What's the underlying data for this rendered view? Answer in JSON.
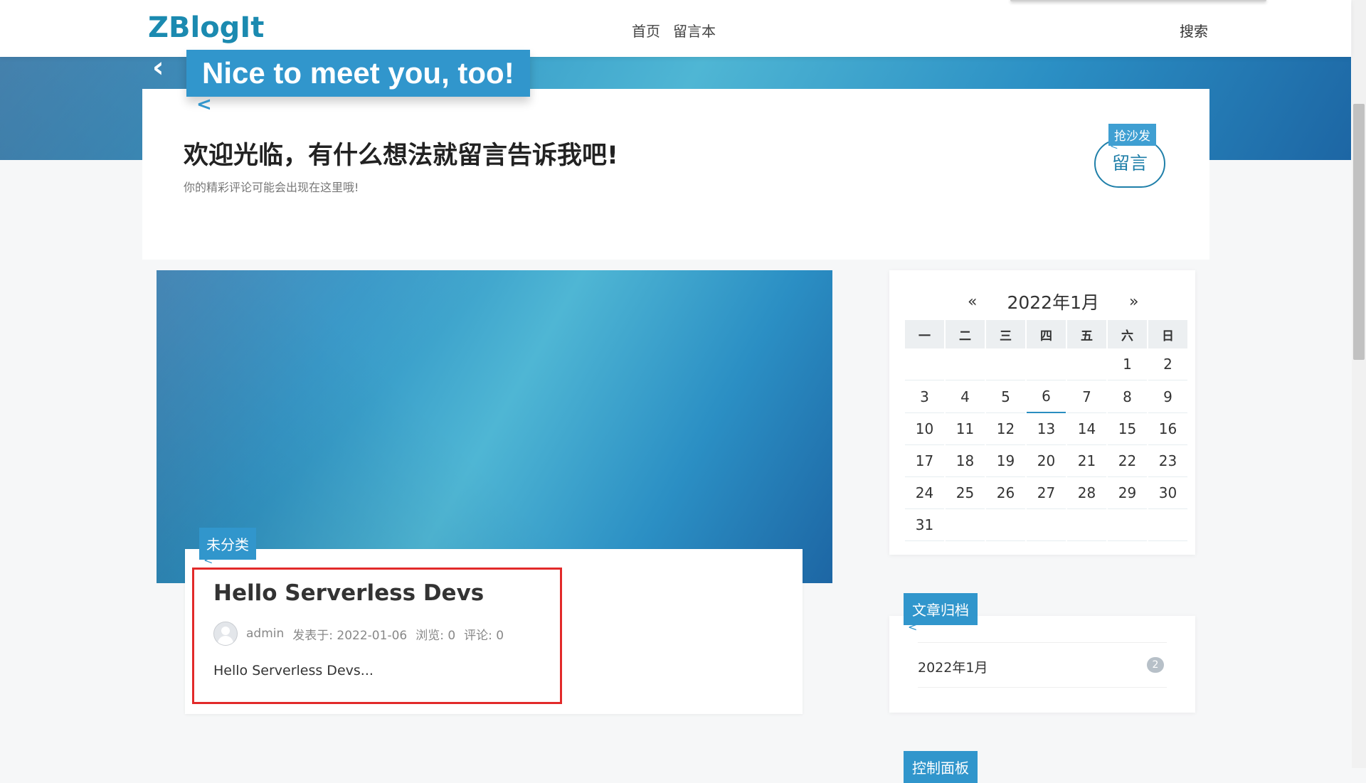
{
  "header": {
    "logo": "ZBlogIt",
    "nav": [
      "首页",
      "留言本"
    ],
    "search_label": "搜索"
  },
  "banner": {
    "ribbon_text": "Nice to meet you, too!"
  },
  "welcome": {
    "title": "欢迎光临，有什么想法就留言告诉我吧!",
    "subtitle": "你的精彩评论可能会出现在这里哦!",
    "sofa_tag": "抢沙发",
    "message_button": "留言"
  },
  "post": {
    "category": "未分类",
    "title": "Hello Serverless Devs",
    "author": "admin",
    "published": "发表于: 2022-01-06",
    "views": "浏览: 0",
    "comments": "评论: 0",
    "excerpt": "Hello Serverless Devs..."
  },
  "calendar": {
    "prev": "«",
    "month": "2022年1月",
    "next": "»",
    "weekdays": [
      "一",
      "二",
      "三",
      "四",
      "五",
      "六",
      "日"
    ],
    "weeks": [
      [
        "",
        "",
        "",
        "",
        "",
        "1",
        "2"
      ],
      [
        "3",
        "4",
        "5",
        "6",
        "7",
        "8",
        "9"
      ],
      [
        "10",
        "11",
        "12",
        "13",
        "14",
        "15",
        "16"
      ],
      [
        "17",
        "18",
        "19",
        "20",
        "21",
        "22",
        "23"
      ],
      [
        "24",
        "25",
        "26",
        "27",
        "28",
        "29",
        "30"
      ],
      [
        "31",
        "",
        "",
        "",
        "",
        "",
        ""
      ]
    ],
    "today": "6"
  },
  "archive": {
    "tag": "文章归档",
    "items": [
      {
        "label": "2022年1月",
        "count": "2"
      }
    ]
  },
  "control_panel": {
    "tag": "控制面板"
  },
  "colors": {
    "accent": "#3196cc",
    "logo": "#1b8ab0",
    "highlight_border": "#e22a2a"
  }
}
